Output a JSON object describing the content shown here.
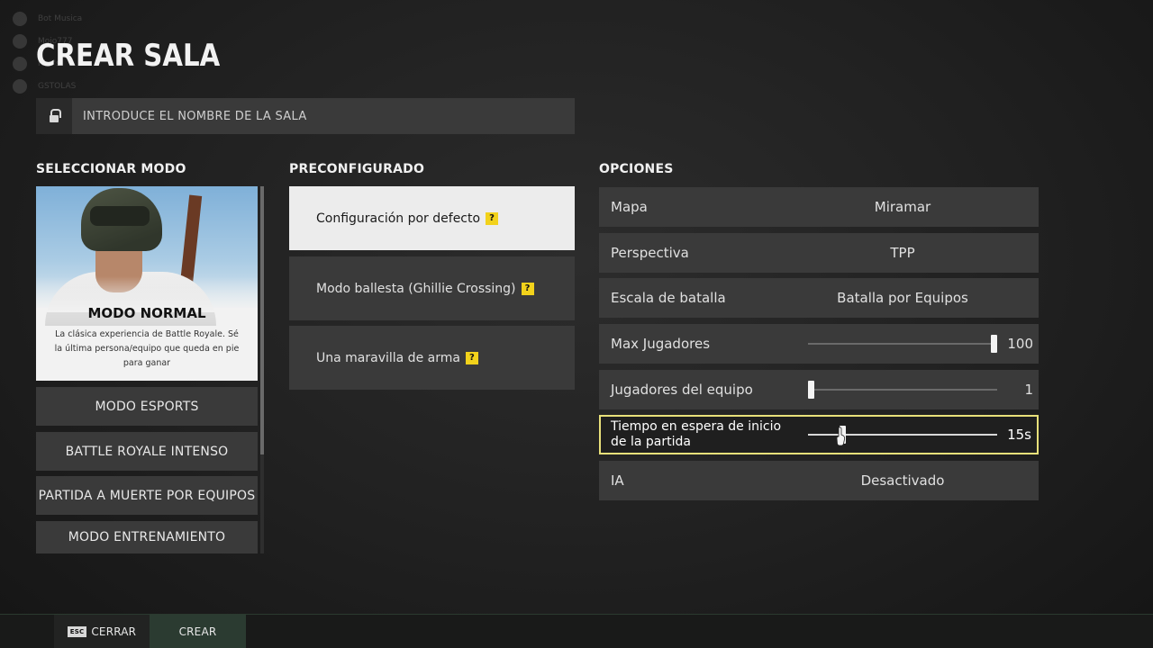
{
  "title": "CREAR SALA",
  "room_name": {
    "placeholder": "INTRODUCE EL NOMBRE DE LA SALA"
  },
  "background_overlay": {
    "items": [
      "Bot Musica",
      "Mojo777",
      "Rhe's",
      "GSTOLAS"
    ]
  },
  "modes": {
    "heading": "SELECCIONAR MODO",
    "featured": {
      "name": "MODO NORMAL",
      "description": "La clásica experiencia de Battle Royale. Sé la última persona/equipo que queda en pie para ganar"
    },
    "items": [
      {
        "label": "MODO ESPORTS"
      },
      {
        "label": "BATTLE ROYALE INTENSO"
      },
      {
        "label": "PARTIDA A MUERTE POR EQUIPOS"
      },
      {
        "label": "MODO ENTRENAMIENTO"
      }
    ]
  },
  "presets": {
    "heading": "PRECONFIGURADO",
    "items": [
      {
        "label": "Configuración por defecto",
        "help": "?"
      },
      {
        "label": "Modo ballesta (Ghillie Crossing)",
        "help": "?"
      },
      {
        "label": "Una maravilla de arma",
        "help": "?"
      }
    ]
  },
  "options": {
    "heading": "OPCIONES",
    "map": {
      "label": "Mapa",
      "value": "Miramar"
    },
    "perspective": {
      "label": "Perspectiva",
      "value": "TPP"
    },
    "scale": {
      "label": "Escala de batalla",
      "value": "Batalla por Equipos"
    },
    "max_players": {
      "label": "Max Jugadores",
      "value": "100",
      "fraction": 1.0
    },
    "team_players": {
      "label": "Jugadores del equipo",
      "value": "1",
      "fraction": 0.0
    },
    "wait_time": {
      "label": "Tiempo en espera de inicio de la partida",
      "value": "15s",
      "fraction": 0.17
    },
    "ai": {
      "label": "IA",
      "value": "Desactivado"
    }
  },
  "footer": {
    "esc_key": "ESC",
    "close_label": "CERRAR",
    "create_label": "CREAR"
  },
  "colors": {
    "accent_focus": "#e8e07a",
    "help_badge": "#f2d21b",
    "create_button": "#2b3b31"
  }
}
